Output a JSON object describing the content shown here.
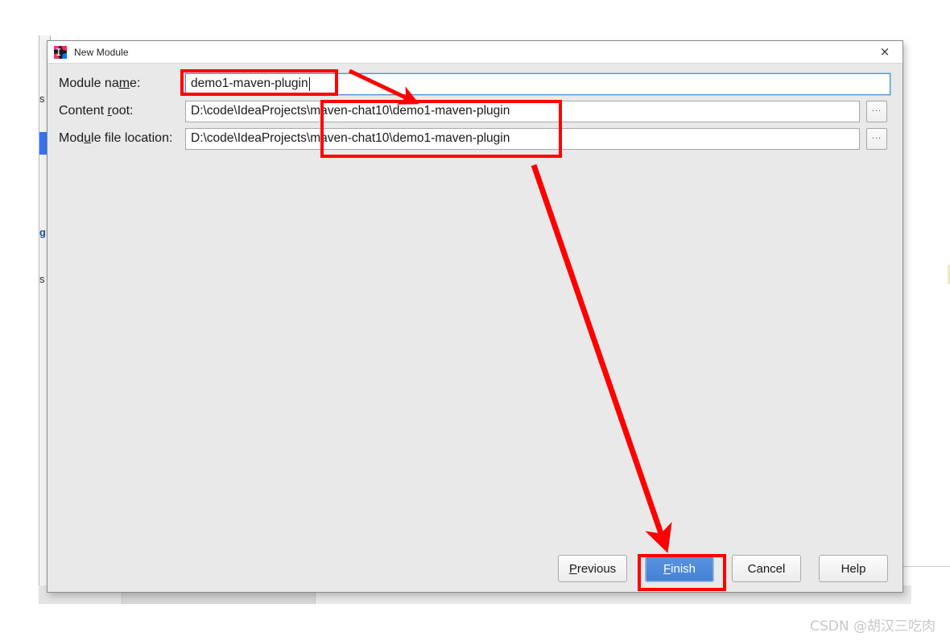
{
  "window": {
    "title": "New Module",
    "icon": "intellij-idea-icon",
    "close_label": "×"
  },
  "form": {
    "rows": [
      {
        "label_before": "Module na",
        "label_mnemonic": "m",
        "label_after": "e:",
        "value": "demo1-maven-plugin",
        "has_browse": false,
        "focused": true
      },
      {
        "label_before": "Content ",
        "label_mnemonic": "r",
        "label_after": "oot:",
        "value": "D:\\code\\IdeaProjects\\maven-chat10\\demo1-maven-plugin",
        "has_browse": true,
        "focused": false
      },
      {
        "label_before": "Mod",
        "label_mnemonic": "u",
        "label_after": "le file location:",
        "value": "D:\\code\\IdeaProjects\\maven-chat10\\demo1-maven-plugin",
        "has_browse": true,
        "focused": false
      }
    ],
    "browse_label": "..."
  },
  "buttons": [
    {
      "before": "",
      "mnemonic": "P",
      "after": "revious",
      "primary": false
    },
    {
      "before": "",
      "mnemonic": "F",
      "after": "inish",
      "primary": true
    },
    {
      "before": "Cancel",
      "mnemonic": "",
      "after": "",
      "primary": false
    },
    {
      "before": "Help",
      "mnemonic": "",
      "after": "",
      "primary": false
    }
  ],
  "background": {
    "fragments": [
      "s",
      "g",
      "s"
    ]
  },
  "annotations": {
    "highlight_color": "#ff0000",
    "boxes": [
      "module-name-field",
      "path-fields",
      "finish-button"
    ],
    "arrows": [
      "arrow-to-path-fields",
      "arrow-to-finish-button"
    ]
  },
  "watermark": {
    "text": "CSDN @胡汉三吃肉"
  }
}
